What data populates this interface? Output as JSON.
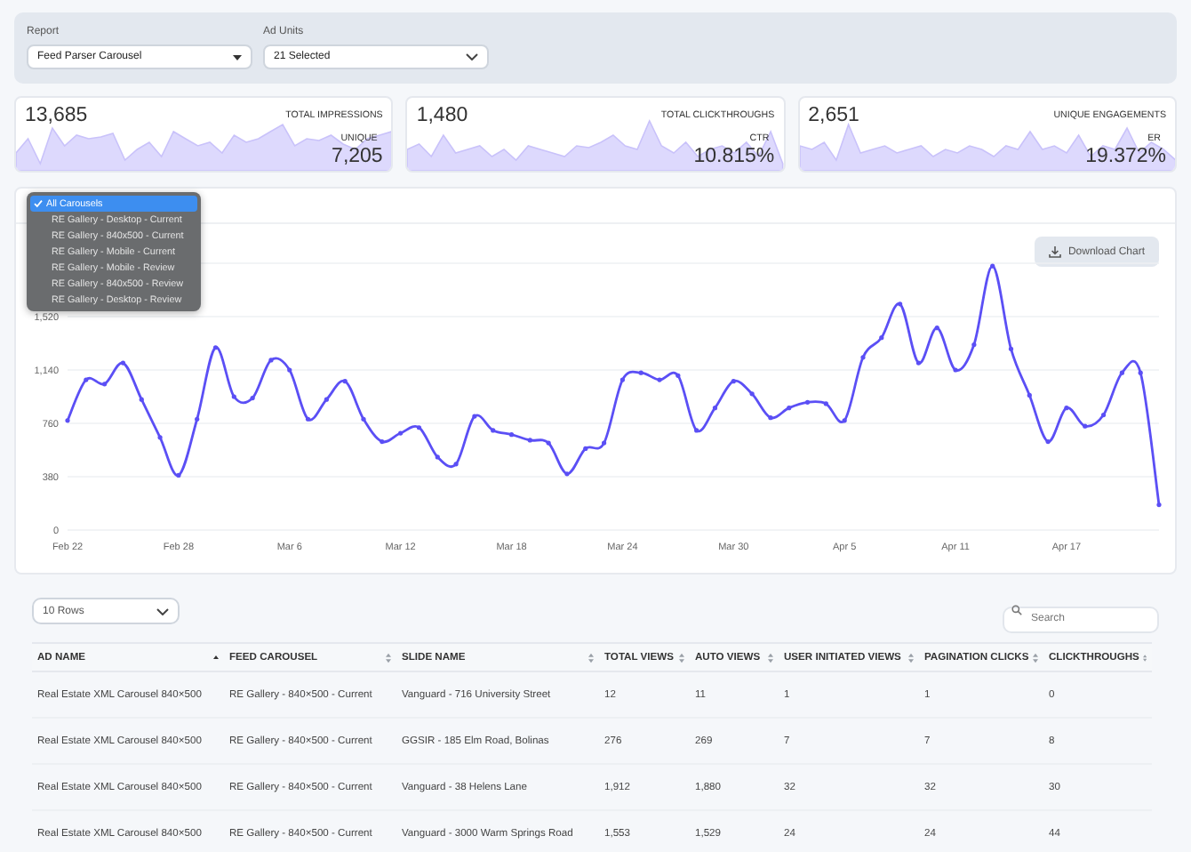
{
  "filters": [
    {
      "label": "Report",
      "value": "Feed Parser Carousel",
      "kind": "caret"
    },
    {
      "label": "Ad Units",
      "value": "21 Selected",
      "kind": "chevron"
    }
  ],
  "kpis": [
    {
      "total": "13,685",
      "total_label": "TOTAL IMPRESSIONS",
      "rate_label": "UNIQUE",
      "rate": "7,205"
    },
    {
      "total": "1,480",
      "total_label": "TOTAL CLICKTHROUGHS",
      "rate_label": "CTR",
      "rate": "10.815%"
    },
    {
      "total": "2,651",
      "total_label": "UNIQUE ENGAGEMENTS",
      "rate_label": "ER",
      "rate": "19.372%"
    }
  ],
  "carousel_menu": {
    "items": [
      {
        "label": "All Carousels",
        "selected": true
      },
      {
        "label": "RE Gallery - Desktop - Current",
        "selected": false
      },
      {
        "label": "RE Gallery - 840x500 - Current",
        "selected": false
      },
      {
        "label": "RE Gallery - Mobile - Current",
        "selected": false
      },
      {
        "label": "RE Gallery - Mobile - Review",
        "selected": false
      },
      {
        "label": "RE Gallery - 840x500 - Review",
        "selected": false
      },
      {
        "label": "RE Gallery - Desktop - Review",
        "selected": false
      }
    ]
  },
  "download_button": "Download Chart",
  "chart_data": {
    "type": "line",
    "categories": [
      "Feb 22",
      null,
      null,
      null,
      null,
      null,
      "Feb 28",
      null,
      null,
      null,
      null,
      null,
      "Mar 6",
      null,
      null,
      null,
      null,
      null,
      "Mar 12",
      null,
      null,
      null,
      null,
      null,
      "Mar 18",
      null,
      null,
      null,
      null,
      null,
      "Mar 24",
      null,
      null,
      null,
      null,
      null,
      "Mar 30",
      null,
      null,
      null,
      null,
      null,
      "Apr 5",
      null,
      null,
      null,
      null,
      null,
      "Apr 11",
      null,
      null,
      null,
      null,
      null,
      "Apr 17",
      null,
      null,
      null,
      null,
      null
    ],
    "series": [
      {
        "color": "#5b4ff5",
        "values": [
          780,
          1070,
          1040,
          1190,
          930,
          660,
          390,
          790,
          1300,
          950,
          940,
          1210,
          1140,
          790,
          930,
          1060,
          790,
          630,
          690,
          730,
          520,
          470,
          810,
          710,
          680,
          640,
          620,
          400,
          580,
          620,
          1070,
          1120,
          1070,
          1100,
          710,
          870,
          1060,
          970,
          800,
          870,
          910,
          900,
          780,
          1230,
          1370,
          1610,
          1190,
          1440,
          1140,
          1320,
          1880,
          1290,
          960,
          630,
          870,
          740,
          820,
          1120,
          1120,
          180
        ]
      }
    ],
    "ylim": [
      0,
      1900
    ],
    "grid": true,
    "yticks": [
      0,
      380,
      760,
      {
        "value": 1140,
        "label": "1,140"
      },
      {
        "value": 1520,
        "label": "1,520"
      }
    ]
  },
  "table": {
    "page_size": "10 Rows",
    "search": {
      "placeholder": "Search"
    },
    "columns": [
      {
        "label": "AD NAME",
        "kind": "ascending"
      },
      {
        "label": "FEED CAROUSEL",
        "kind": "sortable"
      },
      {
        "label": "SLIDE NAME",
        "kind": "sortable"
      },
      {
        "label": "TOTAL VIEWS",
        "kind": "sortable"
      },
      {
        "label": "AUTO VIEWS",
        "kind": "sortable"
      },
      {
        "label": "USER INITIATED VIEWS",
        "kind": "sortable"
      },
      {
        "label": "PAGINATION CLICKS",
        "kind": "sortable"
      },
      {
        "label": "CLICKTHROUGHS",
        "kind": "sortable"
      }
    ],
    "rows": [
      [
        "Real Estate XML Carousel 840×500",
        "RE Gallery - 840×500 - Current",
        "Vanguard - 716 University Street",
        "12",
        "11",
        "1",
        "1",
        "0"
      ],
      [
        "Real Estate XML Carousel 840×500",
        "RE Gallery - 840×500 - Current",
        "GGSIR - 185 Elm Road, Bolinas",
        "276",
        "269",
        "7",
        "7",
        "8"
      ],
      [
        "Real Estate XML Carousel 840×500",
        "RE Gallery - 840×500 - Current",
        "Vanguard - 38 Helens Lane",
        "1,912",
        "1,880",
        "32",
        "32",
        "30"
      ],
      [
        "Real Estate XML Carousel 840×500",
        "RE Gallery - 840×500 - Current",
        "Vanguard - 3000 Warm Springs Road",
        "1,553",
        "1,529",
        "24",
        "24",
        "44"
      ]
    ]
  }
}
